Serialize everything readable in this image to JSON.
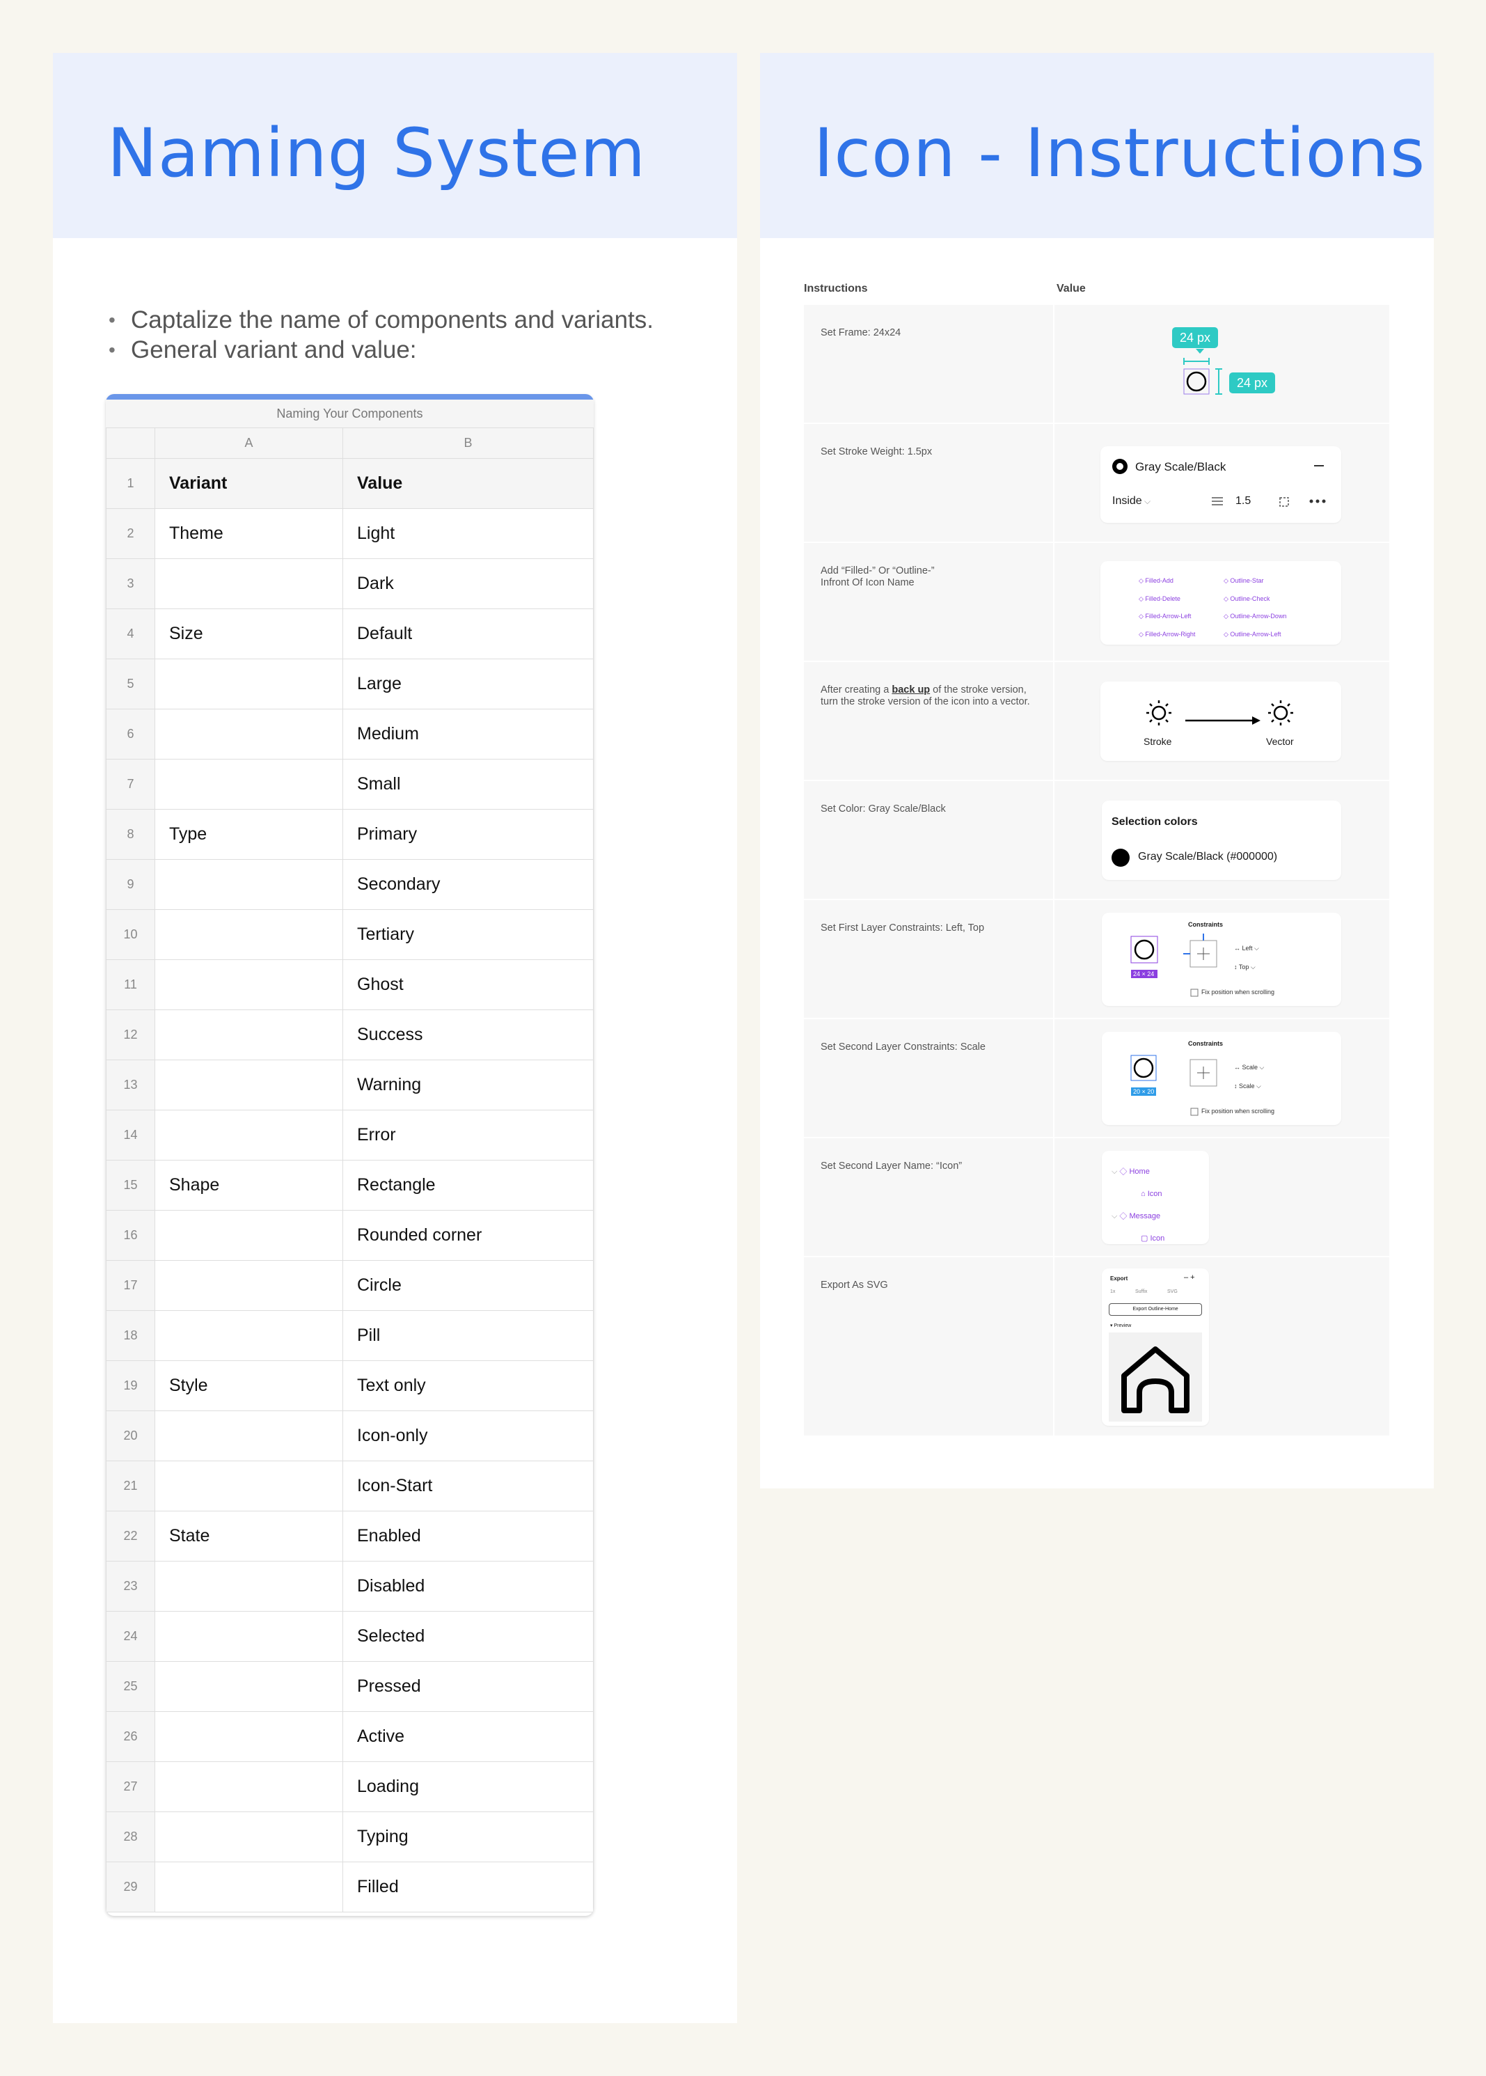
{
  "left_panel": {
    "title": "Naming System",
    "bullets": [
      "Captalize the name of components and variants.",
      "General variant and value:"
    ],
    "sheet": {
      "caption": "Naming Your Components",
      "columns": [
        "A",
        "B"
      ],
      "header": {
        "row": "1",
        "a": "Variant",
        "b": "Value"
      },
      "rows": [
        {
          "n": "2",
          "a": "Theme",
          "b": "Light"
        },
        {
          "n": "3",
          "a": "",
          "b": "Dark"
        },
        {
          "n": "4",
          "a": "Size",
          "b": "Default"
        },
        {
          "n": "5",
          "a": "",
          "b": "Large"
        },
        {
          "n": "6",
          "a": "",
          "b": "Medium"
        },
        {
          "n": "7",
          "a": "",
          "b": "Small"
        },
        {
          "n": "8",
          "a": "Type",
          "b": "Primary"
        },
        {
          "n": "9",
          "a": "",
          "b": "Secondary"
        },
        {
          "n": "10",
          "a": "",
          "b": "Tertiary"
        },
        {
          "n": "11",
          "a": "",
          "b": "Ghost"
        },
        {
          "n": "12",
          "a": "",
          "b": "Success"
        },
        {
          "n": "13",
          "a": "",
          "b": "Warning"
        },
        {
          "n": "14",
          "a": "",
          "b": "Error"
        },
        {
          "n": "15",
          "a": "Shape",
          "b": "Rectangle"
        },
        {
          "n": "16",
          "a": "",
          "b": "Rounded corner"
        },
        {
          "n": "17",
          "a": "",
          "b": "Circle"
        },
        {
          "n": "18",
          "a": "",
          "b": "Pill"
        },
        {
          "n": "19",
          "a": "Style",
          "b": "Text only"
        },
        {
          "n": "20",
          "a": "",
          "b": "Icon-only"
        },
        {
          "n": "21",
          "a": "",
          "b": "Icon-Start"
        },
        {
          "n": "22",
          "a": "State",
          "b": "Enabled"
        },
        {
          "n": "23",
          "a": "",
          "b": "Disabled"
        },
        {
          "n": "24",
          "a": "",
          "b": "Selected"
        },
        {
          "n": "25",
          "a": "",
          "b": "Pressed"
        },
        {
          "n": "26",
          "a": "",
          "b": "Active"
        },
        {
          "n": "27",
          "a": "",
          "b": "Loading"
        },
        {
          "n": "28",
          "a": "",
          "b": "Typing"
        },
        {
          "n": "29",
          "a": "",
          "b": "Filled"
        }
      ]
    }
  },
  "right_panel": {
    "title": "Icon - Instructions",
    "col_instructions": "Instructions",
    "col_value": "Value",
    "steps": [
      "Set Frame: 24x24",
      "Set Stroke Weight: 1.5px",
      "Add “Filled-” Or “Outline-”\nInfront Of Icon Name",
      "After creating a ",
      "Set Color: Gray Scale/Black",
      "Set First Layer Constraints: Left, Top",
      "Set Second Layer Constraints: Scale",
      "Set Second Layer Name: “Icon”",
      "Export As SVG"
    ],
    "step4_bold": "back up",
    "step4_rest": " of the stroke version, turn the stroke version of the icon into a vector.",
    "frame": {
      "tag_w": "24 px",
      "tag_h": "24 px"
    },
    "stroke": {
      "name": "Gray Scale/Black",
      "position": "Inside",
      "weight": "1.5"
    },
    "names": {
      "filled": [
        "Filled-Add",
        "Filled-Delete",
        "Filled-Arrow-Left",
        "Filled-Arrow-Right"
      ],
      "outline": [
        "Outline-Star",
        "Outline-Check",
        "Outline-Arrow-Down",
        "Outline-Arrow-Left"
      ]
    },
    "convert": {
      "from": "Stroke",
      "to": "Vector"
    },
    "color": {
      "title": "Selection colors",
      "value": "Gray Scale/Black (#000000)"
    },
    "constraints1": {
      "title": "Constraints",
      "h": "Left",
      "v": "Top",
      "size": "24 × 24",
      "fix": "Fix position when scrolling"
    },
    "constraints2": {
      "title": "Constraints",
      "h": "Scale",
      "v": "Scale",
      "size": "20 × 20",
      "fix": "Fix position when scrolling"
    },
    "layers": [
      "Home",
      "Icon",
      "Message",
      "Icon"
    ],
    "export": {
      "title": "Export",
      "scale": "1x",
      "suffix": "Suffix",
      "format": "SVG",
      "button": "Export Outline-Home",
      "preview": "Preview"
    }
  },
  "colors": {
    "accent": "#2f73e8",
    "header_bg": "#ebf0fc",
    "teal": "#2ecac4",
    "purple": "#8b3fe0"
  }
}
